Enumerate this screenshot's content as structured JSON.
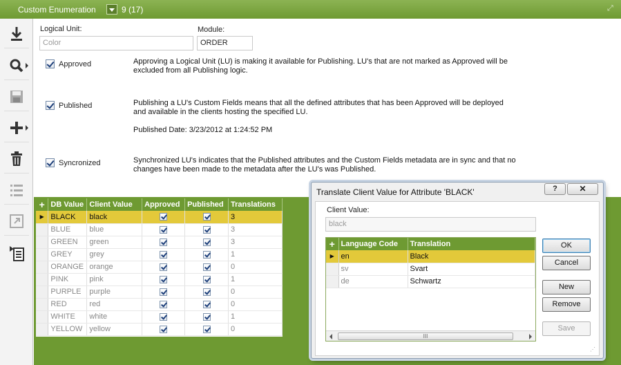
{
  "window": {
    "title": "Custom Enumeration",
    "record_count": "9 (17)"
  },
  "toolbar": {
    "icons": [
      "download-icon",
      "search-icon",
      "save-icon",
      "add-icon",
      "delete-icon",
      "list-icon",
      "expand-icon",
      "detail-icon"
    ]
  },
  "form": {
    "logical_unit_label": "Logical Unit:",
    "logical_unit_value": "Color",
    "module_label": "Module:",
    "module_value": "ORDER",
    "approved": {
      "label": "Approved",
      "desc1": "Approving a Logical Unit (LU) is making it available for Publishing. LU's that are not marked as Approved will be",
      "desc2": "excluded from all Publishing  logic."
    },
    "published": {
      "label": "Published",
      "desc1": "Publishing a LU's Custom Fields means that all the defined attributes that has been Approved will be deployed",
      "desc2": "and available in the clients hosting the specified LU.",
      "date": "Published Date: 3/23/2012 at 1:24:52 PM"
    },
    "synchronized": {
      "label": "Syncronized",
      "desc1": "Synchronized LU's indicates that the Published attributes and the Custom Fields metadata are in sync and that no",
      "desc2": "changes have been made to the metadata after the LU's was Published."
    }
  },
  "grid": {
    "add_symbol": "+",
    "headers": [
      "DB Value",
      "Client Value",
      "Approved",
      "Published",
      "Translations"
    ],
    "rows": [
      {
        "db": "BLACK",
        "client": "black",
        "translations": "3"
      },
      {
        "db": "BLUE",
        "client": "blue",
        "translations": "3"
      },
      {
        "db": "GREEN",
        "client": "green",
        "translations": "3"
      },
      {
        "db": "GREY",
        "client": "grey",
        "translations": "1"
      },
      {
        "db": "ORANGE",
        "client": "orange",
        "translations": "0"
      },
      {
        "db": "PINK",
        "client": "pink",
        "translations": "1"
      },
      {
        "db": "PURPLE",
        "client": "purple",
        "translations": "0"
      },
      {
        "db": "RED",
        "client": "red",
        "translations": "0"
      },
      {
        "db": "WHITE",
        "client": "white",
        "translations": "1"
      },
      {
        "db": "YELLOW",
        "client": "yellow",
        "translations": "0"
      }
    ]
  },
  "dialog": {
    "title": "Translate Client Value for Attribute 'BLACK'",
    "help": "?",
    "close": "✕",
    "client_value_label": "Client Value:",
    "client_value": "black",
    "grid_add_symbol": "+",
    "grid_headers": [
      "Language Code",
      "Translation"
    ],
    "rows": [
      {
        "code": "en",
        "translation": "Black"
      },
      {
        "code": "sv",
        "translation": "Svart"
      },
      {
        "code": "de",
        "translation": "Schwartz"
      }
    ],
    "scroll_thumb": "III",
    "buttons": {
      "ok": "OK",
      "cancel": "Cancel",
      "new": "New",
      "remove": "Remove",
      "save": "Save"
    }
  },
  "colors": {
    "accent_green": "#6e9a32",
    "selection_yellow": "#e3c93a"
  }
}
